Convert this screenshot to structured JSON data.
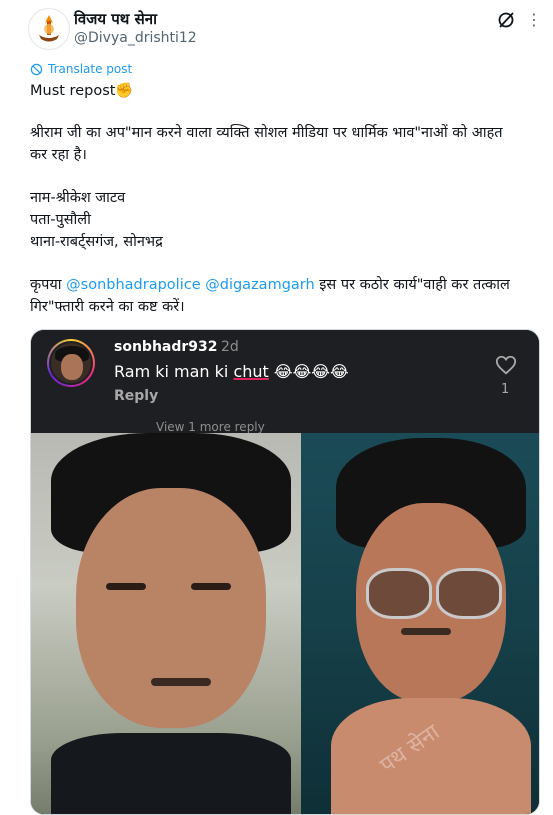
{
  "header": {
    "display_name": "विजय पथ सेना",
    "handle": "@Divya_drishti12",
    "avatar_icon": "party-logo-icon",
    "grok_icon": "grok-icon",
    "more_icon": "more-icon"
  },
  "translate": {
    "label": "Translate post"
  },
  "post": {
    "line1": "Must repost✊",
    "line2": "श्रीराम जी का अप\"मान करने वाला व्यक्ति सोशल मीडिया पर धार्मिक भाव\"नाओं को आहत",
    "line3": "कर रहा है।",
    "line4": "नाम-श्रीकेश जाटव",
    "line5": "पता-पुसौली",
    "line6": "थाना-राबर्ट्सगंज, सोनभद्र",
    "line7_prefix": "कृपया ",
    "mention1": "@sonbhadrapolice",
    "mention2": "@digazamgarh",
    "line7_suffix": " इस पर कठोर कार्य\"वाही कर तत्काल",
    "line8": "गिर\"फ्तारी करने का कष्ट करें।"
  },
  "comment": {
    "username": "sonbhadr932",
    "time": "2d",
    "text_before": "Ram ki man ki ",
    "text_marked": "chut",
    "text_after": " 😂😂😂😂",
    "reply_label": "Reply",
    "more_replies": "View 1 more reply",
    "like_count": "1",
    "heart_icon": "heart-icon"
  },
  "watermark": "पथ सेना",
  "colors": {
    "accent": "#1d9bf0",
    "comment_bg": "#1e1f22",
    "underline": "#e0245e"
  }
}
